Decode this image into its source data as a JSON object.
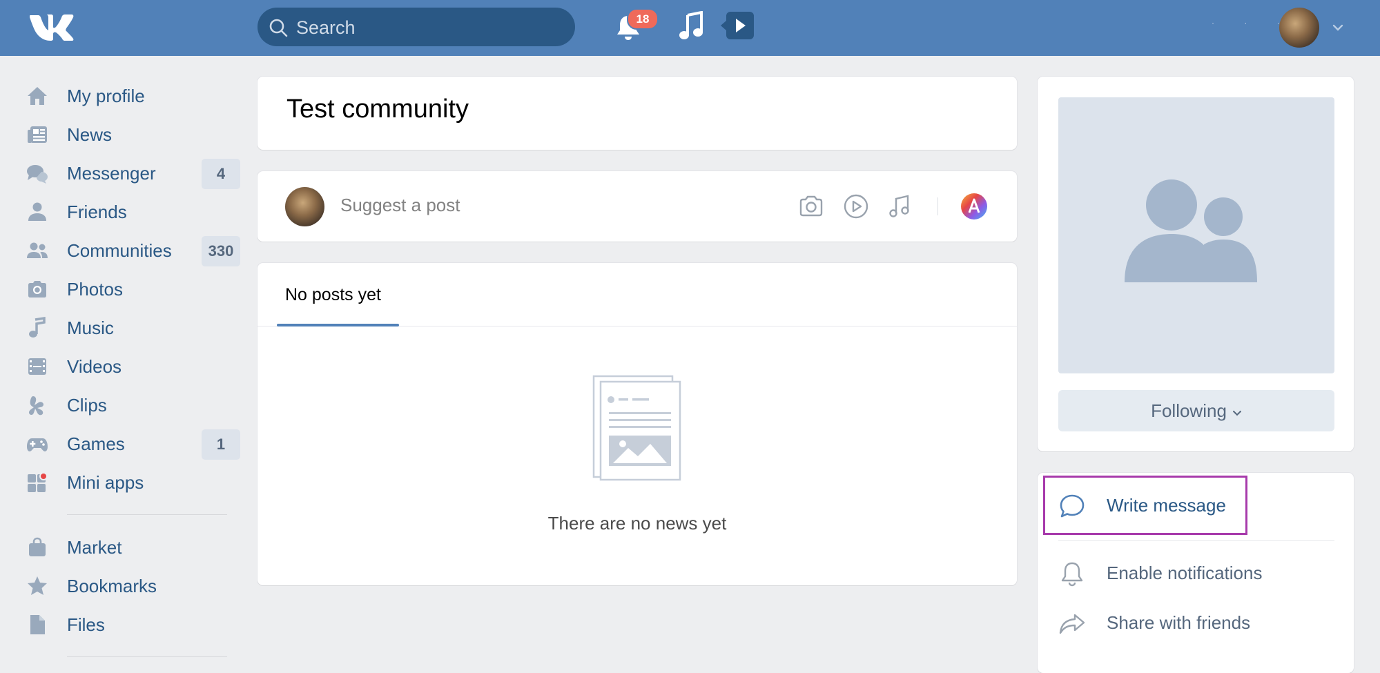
{
  "header": {
    "search_placeholder": "Search",
    "notifications_count": "18",
    "brand_color": "#5181b8"
  },
  "sidebar": {
    "items": [
      {
        "label": "My profile",
        "icon": "home-icon",
        "count": ""
      },
      {
        "label": "News",
        "icon": "newspaper-icon",
        "count": ""
      },
      {
        "label": "Messenger",
        "icon": "chat-bubbles-icon",
        "count": "4"
      },
      {
        "label": "Friends",
        "icon": "person-icon",
        "count": ""
      },
      {
        "label": "Communities",
        "icon": "people-icon",
        "count": "330"
      },
      {
        "label": "Photos",
        "icon": "camera-icon",
        "count": ""
      },
      {
        "label": "Music",
        "icon": "music-note-icon",
        "count": ""
      },
      {
        "label": "Videos",
        "icon": "film-icon",
        "count": ""
      },
      {
        "label": "Clips",
        "icon": "clips-icon",
        "count": ""
      },
      {
        "label": "Games",
        "icon": "gamepad-icon",
        "count": "1"
      },
      {
        "label": "Mini apps",
        "icon": "apps-grid-icon",
        "count": ""
      },
      {
        "label": "Market",
        "icon": "shopping-bag-icon",
        "count": ""
      },
      {
        "label": "Bookmarks",
        "icon": "star-icon",
        "count": ""
      },
      {
        "label": "Files",
        "icon": "file-icon",
        "count": ""
      }
    ]
  },
  "main": {
    "community_title": "Test community",
    "suggest_placeholder": "Suggest a post",
    "tab_label": "No posts yet",
    "empty_text": "There are no news yet"
  },
  "right": {
    "follow_label": "Following",
    "actions": [
      {
        "label": "Write message",
        "icon": "message-bubble-icon",
        "color": "#2a5885"
      },
      {
        "label": "Enable notifications",
        "icon": "bell-icon",
        "color": "#55677d"
      },
      {
        "label": "Share with friends",
        "icon": "share-arrow-icon",
        "color": "#55677d"
      }
    ]
  }
}
